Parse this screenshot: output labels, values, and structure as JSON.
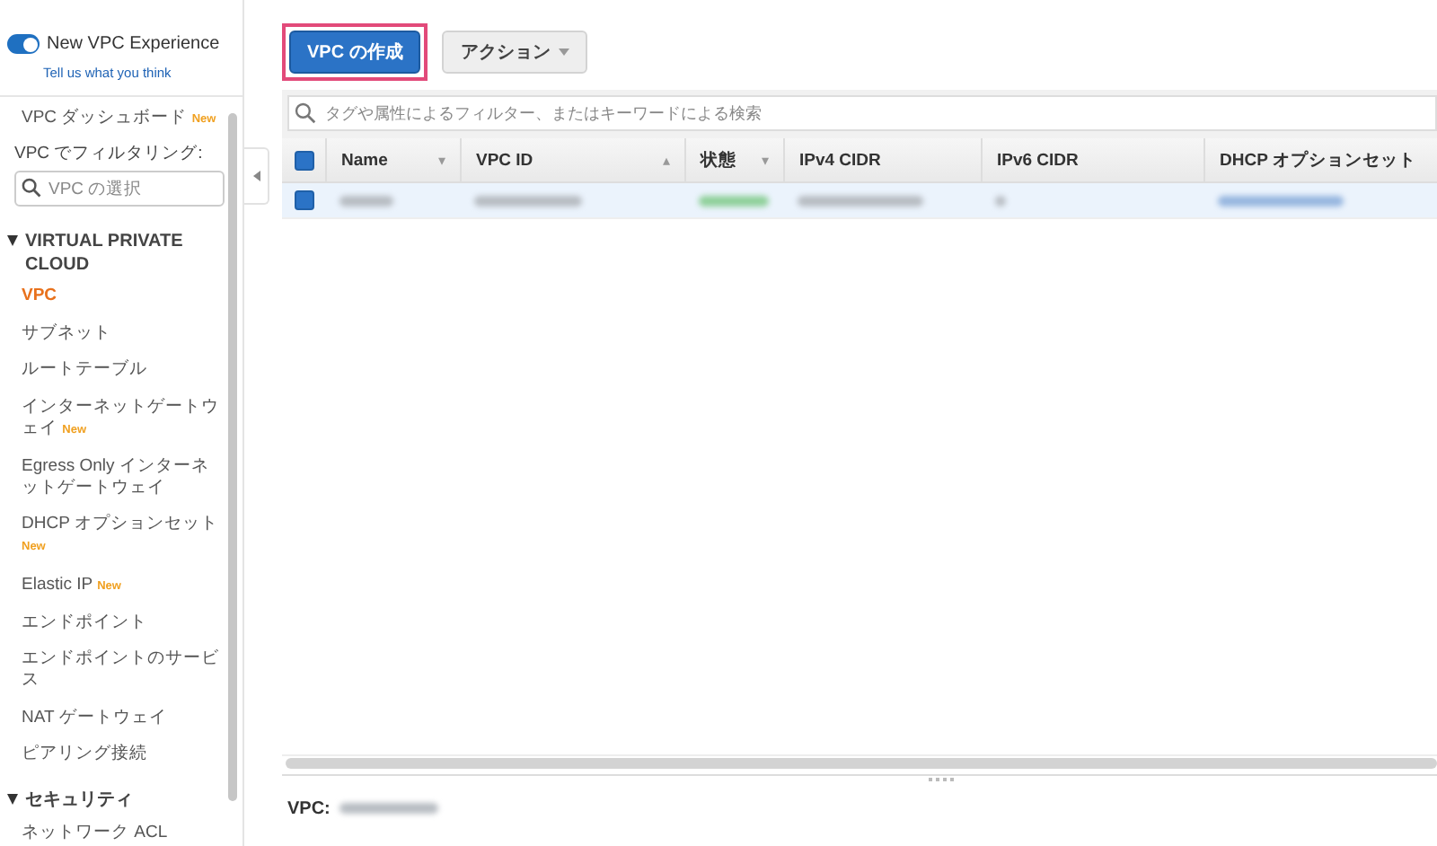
{
  "experience_toggle": {
    "label": "New VPC Experience",
    "on": true,
    "feedback_link": "Tell us what you think"
  },
  "sidebar": {
    "dashboard": {
      "label": "VPC ダッシュボード",
      "badge": "New"
    },
    "filter_label": "VPC でフィルタリング:",
    "filter_field": {
      "placeholder": "VPC の選択"
    },
    "sections": [
      {
        "title": "VIRTUAL PRIVATE CLOUD",
        "expanded": true,
        "items": [
          {
            "label": "VPC",
            "selected": true
          },
          {
            "label": "サブネット",
            "selected": false
          },
          {
            "label": "ルートテーブル",
            "selected": false
          },
          {
            "label": "インターネットゲートウェイ",
            "selected": false,
            "badge": "New"
          },
          {
            "label": "Egress Only インターネットゲートウェイ",
            "selected": false
          },
          {
            "label": "DHCP オプションセット",
            "selected": false,
            "badge": "New"
          },
          {
            "label": "Elastic IP",
            "selected": false,
            "badge": "New"
          },
          {
            "label": "エンドポイント",
            "selected": false
          },
          {
            "label": "エンドポイントのサービス",
            "selected": false
          },
          {
            "label": "NAT ゲートウェイ",
            "selected": false
          },
          {
            "label": "ピアリング接続",
            "selected": false
          }
        ]
      },
      {
        "title": "セキュリティ",
        "expanded": true,
        "items": [
          {
            "label": "ネットワーク ACL",
            "selected": false
          }
        ]
      }
    ]
  },
  "toolbar": {
    "buttons": [
      {
        "label": "VPC の作成",
        "kind": "primary",
        "highlighted": true
      },
      {
        "label": "アクション",
        "kind": "dropdown",
        "highlighted": false
      }
    ]
  },
  "search": {
    "placeholder": "タグや属性によるフィルター、またはキーワードによる検索"
  },
  "table": {
    "columns": [
      {
        "label": "Name",
        "sort_icon": "▾"
      },
      {
        "label": "VPC ID",
        "sort_icon": "▴"
      },
      {
        "label": "状態",
        "sort_icon": "▾"
      },
      {
        "label": "IPv4 CIDR"
      },
      {
        "label": "IPv6 CIDR"
      },
      {
        "label": "DHCP オプションセット"
      }
    ],
    "header_checked": true,
    "rows": [
      {
        "selected": true,
        "checked": true
      }
    ]
  },
  "details": {
    "label": "VPC:"
  }
}
